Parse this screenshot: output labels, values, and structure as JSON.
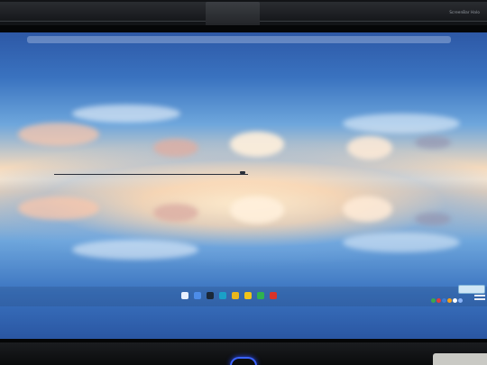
{
  "lightbar": {
    "brand_text": "ScreenBar Halo"
  },
  "wallpaper": {
    "description_colors": {
      "sky_top": "#2d58a6",
      "horizon_glow": "#fbe7cf",
      "sky_mid": "#6ea6dc"
    }
  },
  "taskbar": {
    "icons": [
      {
        "name": "windows-start-icon",
        "color": "#e9f1ff"
      },
      {
        "name": "file-explorer-icon",
        "color": "#4d8de8"
      },
      {
        "name": "steam-icon",
        "color": "#1b2838"
      },
      {
        "name": "edge-browser-icon",
        "color": "#1aa0c8"
      },
      {
        "name": "chrome-browser-icon",
        "color": "#e8b71d"
      },
      {
        "name": "app-yellow-icon",
        "color": "#f0c419"
      },
      {
        "name": "app-green-icon",
        "color": "#2fb24f"
      },
      {
        "name": "app-red-icon",
        "color": "#d9342b"
      }
    ],
    "tray": {
      "flyout_color": "#cfe6f5",
      "dots": [
        "#3ea84a",
        "#e23c3c",
        "#3a7bd5",
        "#f4a11b",
        "#ffffff",
        "#8ab4f8"
      ]
    }
  },
  "stand": {
    "logo_color": "#3b63ff"
  }
}
